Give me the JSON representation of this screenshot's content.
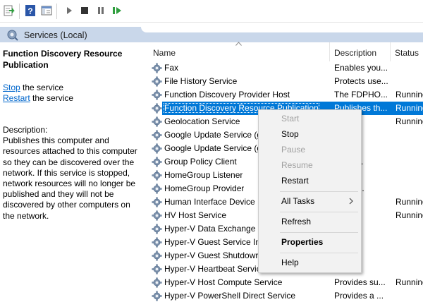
{
  "toolbar": {
    "icons": [
      "export-list-icon",
      "help-icon",
      "show-hide-pane-icon",
      "start-service-icon",
      "stop-service-icon",
      "pause-service-icon",
      "restart-service-icon"
    ]
  },
  "header": {
    "title": "Services (Local)"
  },
  "left_pane": {
    "service_title": "Function Discovery Resource Publication",
    "stop_link": "Stop",
    "stop_suffix": " the service",
    "restart_link": "Restart",
    "restart_suffix": " the service",
    "description_label": "Description:",
    "description_text": "Publishes this computer and resources attached to this computer so they can be discovered over the network.  If this service is stopped, network resources will no longer be published and they will not be discovered by other computers on the network."
  },
  "columns": {
    "name": "Name",
    "description": "Description",
    "status": "Status"
  },
  "services": [
    {
      "name": "Fax",
      "description": "Enables you...",
      "status": ""
    },
    {
      "name": "File History Service",
      "description": "Protects use...",
      "status": ""
    },
    {
      "name": "Function Discovery Provider Host",
      "description": "The FDPHO...",
      "status": "Running"
    },
    {
      "name": "Function Discovery Resource Publication",
      "description": "Publishes th...",
      "status": "Running"
    },
    {
      "name": "Geolocation Service",
      "description": "rvice ...",
      "status": "Running"
    },
    {
      "name": "Google Update Service (g",
      "description": "…",
      "status": ""
    },
    {
      "name": "Google Update Service (g",
      "description": "",
      "status": ""
    },
    {
      "name": "Group Policy Client",
      "description": "rvice i...",
      "status": ""
    },
    {
      "name": "HomeGroup Listener",
      "description": "local ...",
      "status": ""
    },
    {
      "name": "HomeGroup Provider",
      "description": "ns net...",
      "status": ""
    },
    {
      "name": "Human Interface Device",
      "description": "es ge...",
      "status": "Running"
    },
    {
      "name": "HV Host Service",
      "description": "es an...",
      "status": "Running"
    },
    {
      "name": "Hyper-V Data Exchange S",
      "description": "es a ...",
      "status": ""
    },
    {
      "name": "Hyper-V Guest Service In",
      "description": "es an...",
      "status": ""
    },
    {
      "name": "Hyper-V Guest Shutdowr",
      "description": "es a ...",
      "status": ""
    },
    {
      "name": "Hyper-V Heartbeat Servic",
      "description": "es a ...",
      "status": ""
    },
    {
      "name": "Hyper-V Host Compute Service",
      "description": "Provides su...",
      "status": "Running"
    },
    {
      "name": "Hyper-V PowerShell Direct Service",
      "description": "Provides a ...",
      "status": ""
    }
  ],
  "context_menu": {
    "start": "Start",
    "stop": "Stop",
    "pause": "Pause",
    "resume": "Resume",
    "restart": "Restart",
    "all_tasks": "All Tasks",
    "refresh": "Refresh",
    "properties": "Properties",
    "help": "Help"
  },
  "colors": {
    "selection": "#0078d7",
    "header_band": "#c9d7ea",
    "link": "#0066cc"
  }
}
